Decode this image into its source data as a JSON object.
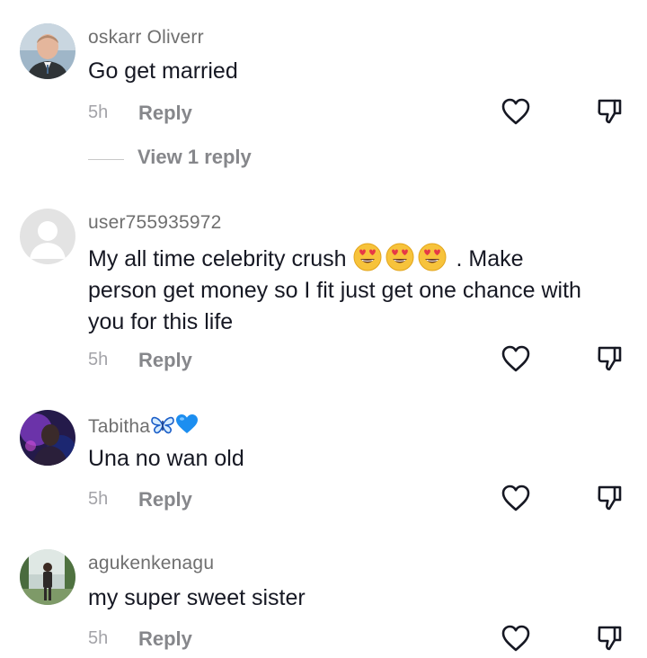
{
  "comments": [
    {
      "username": "oskarr Oliverr",
      "text": "Go get married",
      "time": "5h",
      "reply_label": "Reply",
      "view_replies": "View 1 reply",
      "avatar": "profile-photo-man"
    },
    {
      "username": "user755935972",
      "text_before": "My all time celebrity crush",
      "emojis": [
        "heart-eyes-emoji",
        "heart-eyes-emoji",
        "heart-eyes-emoji"
      ],
      "text_after": ". Make person get money so I fit just get one chance with you for this life",
      "time": "5h",
      "reply_label": "Reply",
      "avatar": "default-avatar"
    },
    {
      "username": "Tabitha",
      "username_icons": [
        "butterfly-icon",
        "blue-heart-icon"
      ],
      "text": "Una no wan old",
      "time": "5h",
      "reply_label": "Reply",
      "avatar": "profile-photo-dark"
    },
    {
      "username": "agukenkenagu",
      "text": "my super sweet sister",
      "time": "5h",
      "reply_label": "Reply",
      "avatar": "profile-photo-outdoor"
    }
  ],
  "colors": {
    "username": "#6f6f6f",
    "text": "#161823",
    "meta": "#a3a3a8",
    "reply": "#86878b",
    "blue_heart": "#1c8ef0"
  }
}
